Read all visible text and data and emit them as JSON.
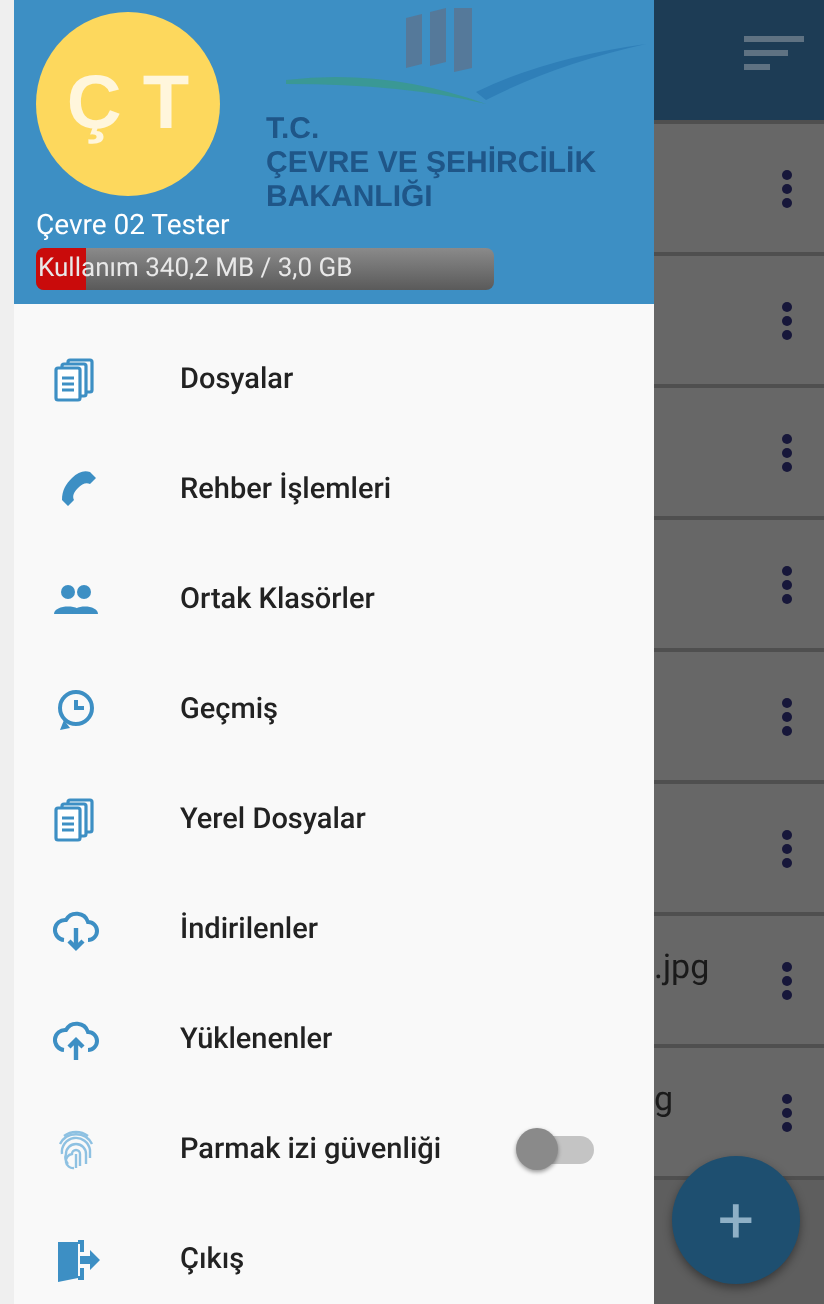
{
  "header": {
    "avatar_initials": "Ç T",
    "logo_text": [
      "T.C.",
      "ÇEVRE VE ŞEHİRCİLİK",
      "BAKANLIĞI"
    ],
    "user_name": "Çevre 02 Tester",
    "usage": {
      "label": "Kullanım 340,2 MB / 3,0 GB",
      "level": 0.11
    }
  },
  "menu": [
    {
      "kind": "link",
      "label": "Dosyalar"
    },
    {
      "kind": "link",
      "label": "Rehber İşlemleri"
    },
    {
      "kind": "link",
      "label": "Ortak Klasörler"
    },
    {
      "kind": "link",
      "label": "Geçmiş"
    },
    {
      "kind": "link",
      "label": "Yerel Dosyalar"
    },
    {
      "kind": "link",
      "label": "İndirilenler"
    },
    {
      "kind": "link",
      "label": "Yüklenenler"
    },
    {
      "kind": "toggle",
      "label": "Parmak izi güvenliği",
      "on": false
    },
    {
      "kind": "link",
      "label": "Çıkış"
    }
  ],
  "background_list": {
    "rows": [
      {},
      {},
      {},
      {},
      {},
      {},
      {
        "name": ".jpg"
      },
      {
        "name": "g"
      }
    ],
    "fab": {
      "label": "+"
    }
  }
}
